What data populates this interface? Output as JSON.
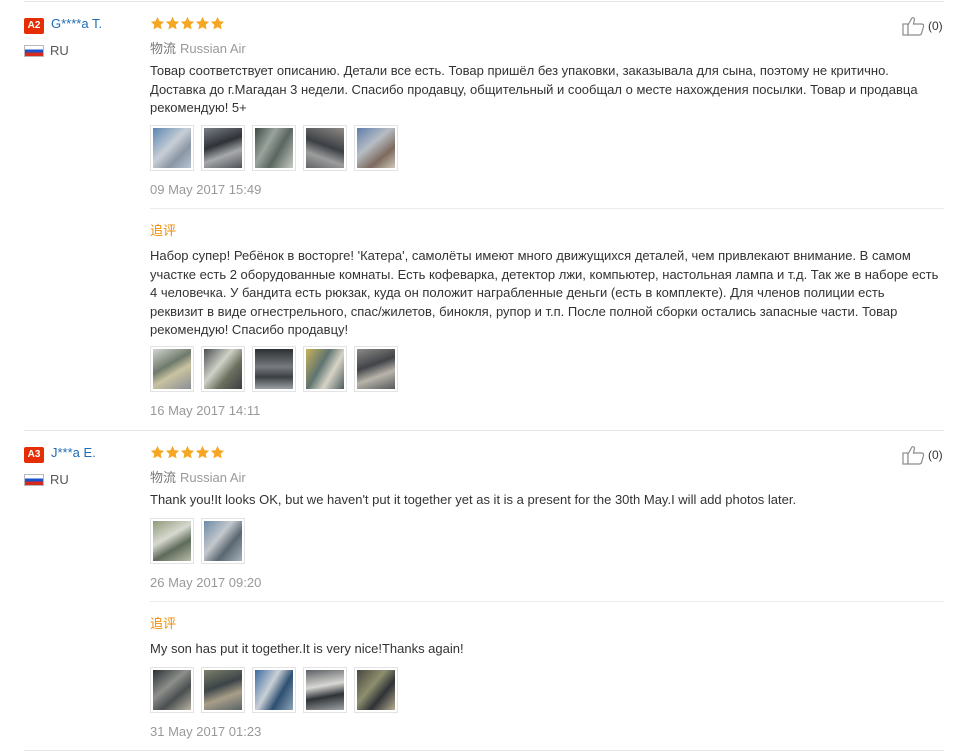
{
  "reviews": [
    {
      "level": "A2",
      "user": "G****a T.",
      "country": "RU",
      "rating": 5,
      "shipping_label": "物流",
      "shipping_value": "Russian Air",
      "helpful_count": "(0)",
      "text": "Товар соответствует описанию. Детали все есть. Товар пришёл без упаковки, заказывала для сына, поэтому не критично. Доставка до г.Магадан 3 недели. Спасибо продавцу, общительный и сообщал о месте нахождения посылки. Товар и продавца рекомендую! 5+",
      "photo_count": 5,
      "date": "09 May 2017 15:49",
      "followup": {
        "label": "追评",
        "text": "Набор супер! Ребёнок в восторге! 'Катера', самолёты имеют много движущихся деталей, чем привлекают внимание. В самом участке есть 2 оборудованные комнаты. Есть кофеварка, детектор лжи, компьютер, настольная лампа и т.д. Так же в наборе есть 4 человечка. У бандита есть рюкзак, куда он положит награбленные деньги (есть в комплекте). Для членов полиции есть реквизит в виде огнестрельного, спас/жилетов, бинокля, рупор и т.п. После полной сборки остались запасные части. Товар рекомендую! Спасибо продавцу!",
        "photo_count": 5,
        "date": "16 May 2017 14:11"
      }
    },
    {
      "level": "A3",
      "user": "J***a E.",
      "country": "RU",
      "rating": 5,
      "shipping_label": "物流",
      "shipping_value": "Russian Air",
      "helpful_count": "(0)",
      "text": "Thank you!It looks OK, but we haven't put it together yet as it is a present for the 30th May.I will add photos later.",
      "photo_count": 2,
      "date": "26 May 2017 09:20",
      "followup": {
        "label": "追评",
        "text": "My son has put it together.It is very nice!Thanks again!",
        "photo_count": 5,
        "date": "31 May 2017 01:23"
      }
    }
  ],
  "colors": {
    "badge": "#e62e04",
    "username": "#1f6bb5",
    "star": "#f5a623",
    "followup": "#f08c00"
  }
}
